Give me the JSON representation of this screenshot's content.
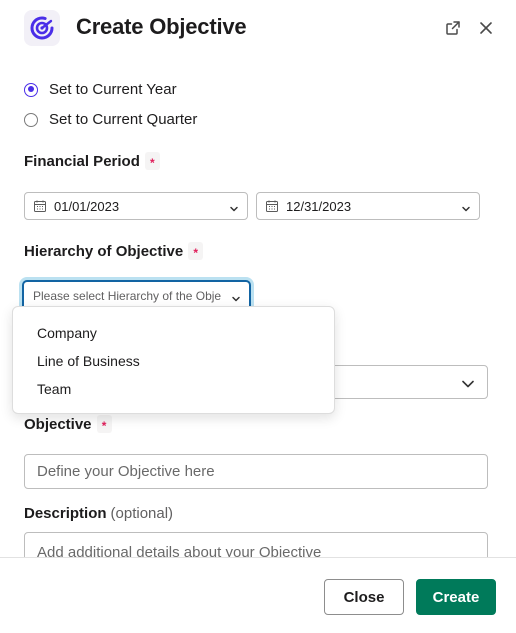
{
  "header": {
    "title": "Create Objective",
    "logo_icon": "objective-target-icon",
    "actions": [
      "popout-icon",
      "close-icon"
    ]
  },
  "period_options": [
    {
      "label": "Set to Current Year",
      "checked": true
    },
    {
      "label": "Set to Current Quarter",
      "checked": false
    }
  ],
  "financial_period": {
    "label": "Financial Period",
    "required_mark": "*",
    "start_date": "01/01/2023",
    "end_date": "12/31/2023"
  },
  "hierarchy": {
    "label": "Hierarchy of Objective",
    "required_mark": "*",
    "placeholder": "Please select Hierarchy of the Objective",
    "options": [
      "Company",
      "Line of Business",
      "Team"
    ]
  },
  "objective": {
    "label": "Objective",
    "required_mark": "*",
    "placeholder": "Define your Objective here"
  },
  "description": {
    "label": "Description",
    "optional_text": "(optional)",
    "placeholder": "Add additional details about your Objective"
  },
  "footer": {
    "close_label": "Close",
    "create_label": "Create"
  },
  "colors": {
    "accent": "#4a2ee8",
    "primary_button": "#007a5a",
    "required": "#e01e5a",
    "focus_ring": "#1264a3"
  }
}
